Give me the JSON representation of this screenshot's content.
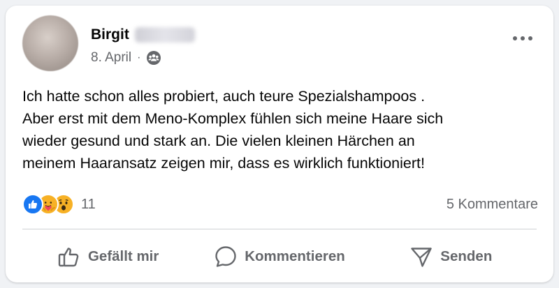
{
  "post": {
    "author": {
      "first_name": "Birgit",
      "surname_blurred": "Albert"
    },
    "date": "8. April",
    "separator": "·",
    "audience_icon": "friends-group-icon",
    "more_icon": "more-options-icon",
    "text_lines": [
      "Ich hatte schon alles probiert, auch teure Spezialshampoos .",
      "Aber erst mit dem Meno-Komplex fühlen sich meine Haare sich",
      "wieder gesund und stark an. Die vielen kleinen Härchen an",
      "meinem Haaransatz zeigen mir, dass es wirklich funktioniert!"
    ],
    "reactions": {
      "types": [
        "like",
        "care",
        "wow"
      ],
      "count": "11"
    },
    "comments_label": "5 Kommentare"
  },
  "actions": {
    "like_label": "Gefällt mir",
    "comment_label": "Kommentieren",
    "send_label": "Senden"
  },
  "colors": {
    "accent": "#1877f2",
    "text_primary": "#050505",
    "text_secondary": "#65676b",
    "divider": "#ced0d4",
    "emoji_yellow": "#f7b125"
  }
}
